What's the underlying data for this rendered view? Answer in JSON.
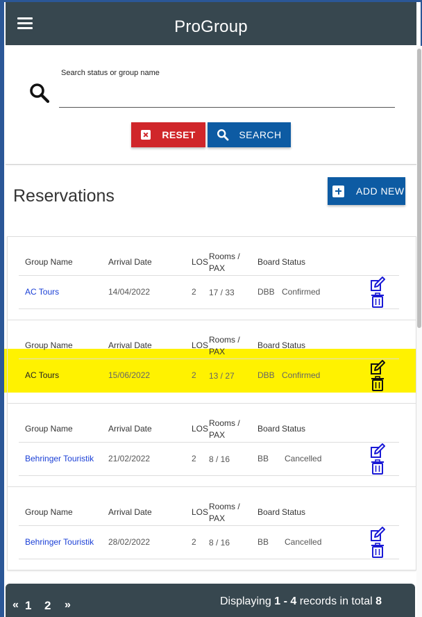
{
  "app": {
    "title": "ProGroup"
  },
  "search": {
    "label": "Search status or group name",
    "value": "",
    "reset_label": "RESET",
    "search_label": "SEARCH"
  },
  "page": {
    "heading": "Reservations",
    "add_new_label": "ADD NEW"
  },
  "columns": {
    "group_name": "Group Name",
    "arrival_date": "Arrival Date",
    "los": "LOS",
    "rooms_pax": "Rooms / PAX",
    "board": "Board",
    "status": "Status"
  },
  "reservations": [
    {
      "group_name": "AC Tours",
      "arrival_date": "14/04/2022",
      "los": "2",
      "rooms_pax": "17 / 33",
      "board": "DBB",
      "status": "Confirmed",
      "highlighted": false
    },
    {
      "group_name": "AC Tours",
      "arrival_date": "15/06/2022",
      "los": "2",
      "rooms_pax": "13 / 27",
      "board": "DBB",
      "status": "Confirmed",
      "highlighted": true
    },
    {
      "group_name": "Behringer Touristik",
      "arrival_date": "21/02/2022",
      "los": "2",
      "rooms_pax": "8 / 16",
      "board": "BB",
      "status": "Cancelled",
      "highlighted": false
    },
    {
      "group_name": "Behringer Touristik",
      "arrival_date": "28/02/2022",
      "los": "2",
      "rooms_pax": "8 / 16",
      "board": "BB",
      "status": "Cancelled",
      "highlighted": false
    }
  ],
  "pagination": {
    "prev": "«",
    "pages": [
      "1",
      "2"
    ],
    "next": "»",
    "info_prefix": "Displaying ",
    "info_range": "1 - 4",
    "info_middle": " records in total ",
    "info_total": "8"
  },
  "colors": {
    "appbar": "#37474f",
    "reset": "#d0262a",
    "primary": "#0d5ba3",
    "link": "#1a3fd6",
    "highlight": "#fff200"
  },
  "icons": {
    "menu": "hamburger-icon",
    "search": "search-icon",
    "edit": "edit-icon",
    "delete": "trash-icon"
  }
}
